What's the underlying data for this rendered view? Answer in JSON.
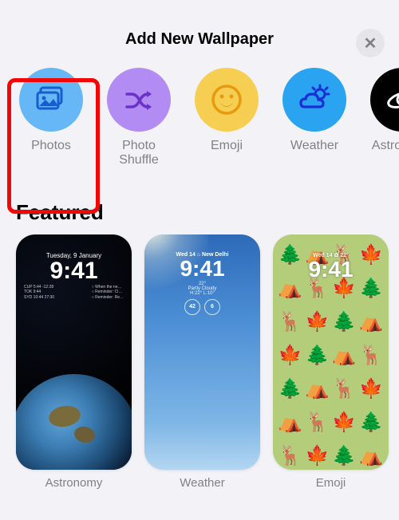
{
  "header": {
    "title": "Add New Wallpaper",
    "close_label": "✕"
  },
  "categories": [
    {
      "id": "photos",
      "label": "Photos"
    },
    {
      "id": "shuffle",
      "label": "Photo Shuffle"
    },
    {
      "id": "emoji",
      "label": "Emoji"
    },
    {
      "id": "weather",
      "label": "Weather"
    },
    {
      "id": "astro",
      "label": "Astronomy"
    }
  ],
  "section": {
    "featured_title": "Featured"
  },
  "featured": [
    {
      "id": "astronomy",
      "label": "Astronomy",
      "lock_date": "Tuesday, 9 January",
      "lock_time": "9:41",
      "info_left_1": "CUP  5:44 -12:28",
      "info_left_2": "TOK  9:44",
      "info_left_3": "SYD  10:44 27:30",
      "info_right_1": "○ When the ne…",
      "info_right_2": "○ Reminder: Cl…",
      "info_right_3": "○ Reminder: Re…"
    },
    {
      "id": "weather",
      "label": "Weather",
      "top_line": "Wed 14  ⌂ New Delhi",
      "lock_time": "9:41",
      "sub1": "22°",
      "sub2": "Partly Cloudy",
      "sub3": "H:22° L:10°",
      "circle1": "42",
      "circle2": "6"
    },
    {
      "id": "emoji",
      "label": "Emoji",
      "top_line": "Wed 14  ✿ 22°",
      "lock_time": "9:41"
    }
  ],
  "emoji_grid": [
    "🌲",
    "⛺",
    "🦌",
    "🍁",
    "⛺",
    "🦌",
    "🍁",
    "🌲",
    "🦌",
    "🍁",
    "🌲",
    "⛺",
    "🍁",
    "🌲",
    "⛺",
    "🦌",
    "🌲",
    "⛺",
    "🦌",
    "🍁",
    "⛺",
    "🦌",
    "🍁",
    "🌲",
    "🦌",
    "🍁",
    "🌲",
    "⛺"
  ]
}
